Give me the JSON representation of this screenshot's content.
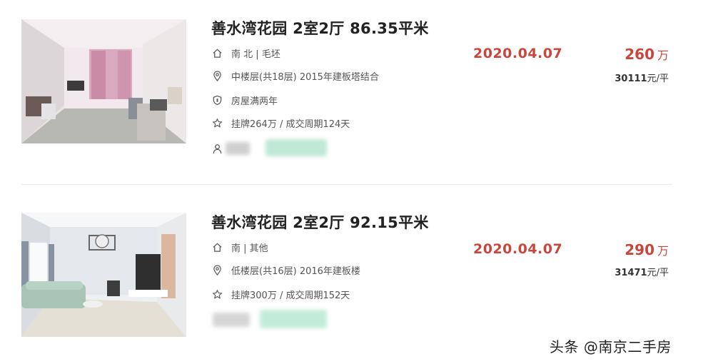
{
  "listings": [
    {
      "title": "善水湾花园 2室2厅 86.35平米",
      "orientation": "南 北 | 毛坯",
      "floor_info": "中楼层(共18层) 2015年建板塔结合",
      "tag": "房屋满两年",
      "listing_info": "挂牌264万 / 成交周期124天",
      "deal_date": "2020.04.07",
      "total_price": "260",
      "total_price_unit": "万",
      "unit_price": "30111",
      "unit_price_suffix": "元/平"
    },
    {
      "title": "善水湾花园 2室2厅 92.15平米",
      "orientation": "南 | 其他",
      "floor_info": "低楼层(共16层) 2016年建板楼",
      "listing_info": "挂牌300万 / 成交周期152天",
      "deal_date": "2020.04.07",
      "total_price": "290",
      "total_price_unit": "万",
      "unit_price": "31471",
      "unit_price_suffix": "元/平"
    }
  ],
  "watermark": "头条 @南京二手房",
  "colors": {
    "accent": "#c9463d",
    "title": "#222222",
    "text": "#555555",
    "divider": "#ececec"
  },
  "icons": {
    "house": "house-icon",
    "location": "location-pin-icon",
    "shield": "shield-icon",
    "star": "star-icon",
    "person": "person-icon"
  }
}
